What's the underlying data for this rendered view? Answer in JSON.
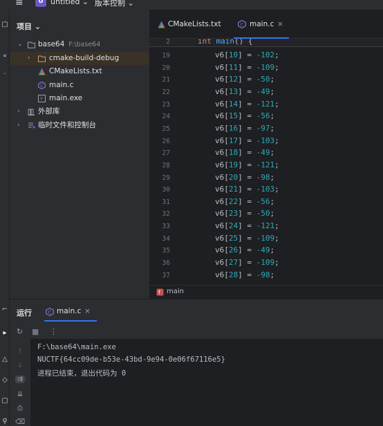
{
  "title_bar": {
    "menu_icon": "hamburger-icon",
    "project_badge": "U",
    "project_name": "untitled ⌄",
    "vcs_label": "版本控制 ⌄"
  },
  "project_panel": {
    "header": "项目 ⌄",
    "tree": [
      {
        "label": "base64",
        "path": "F:\\base64",
        "icon": "folder-icon"
      },
      {
        "label": "cmake-build-debug",
        "icon": "folder-icon"
      },
      {
        "label": "CMakeLists.txt",
        "icon": "cmake-icon"
      },
      {
        "label": "main.c",
        "icon": "c-file-icon"
      },
      {
        "label": "main.exe",
        "icon": "exe-icon"
      },
      {
        "label": "外部库",
        "icon": "library-icon"
      },
      {
        "label": "临时文件和控制台",
        "icon": "scratch-icon"
      }
    ]
  },
  "editor": {
    "tabs": [
      {
        "label": "CMakeLists.txt",
        "icon": "cmake-icon"
      },
      {
        "label": "main.c",
        "icon": "c-file-icon",
        "close": "×"
      }
    ],
    "sticky": {
      "line": "2",
      "pre": "int ",
      "fn": "main",
      "post": "() {"
    },
    "lines": [
      {
        "n": "19",
        "idx": "10",
        "val": "-102"
      },
      {
        "n": "20",
        "idx": "11",
        "val": "-109"
      },
      {
        "n": "21",
        "idx": "12",
        "val": "-50"
      },
      {
        "n": "22",
        "idx": "13",
        "val": "-49"
      },
      {
        "n": "23",
        "idx": "14",
        "val": "-121"
      },
      {
        "n": "24",
        "idx": "15",
        "val": "-56"
      },
      {
        "n": "25",
        "idx": "16",
        "val": "-97"
      },
      {
        "n": "26",
        "idx": "17",
        "val": "-103"
      },
      {
        "n": "27",
        "idx": "18",
        "val": "-49"
      },
      {
        "n": "28",
        "idx": "19",
        "val": "-121"
      },
      {
        "n": "29",
        "idx": "20",
        "val": "-98"
      },
      {
        "n": "30",
        "idx": "21",
        "val": "-103"
      },
      {
        "n": "31",
        "idx": "22",
        "val": "-56"
      },
      {
        "n": "32",
        "idx": "23",
        "val": "-50"
      },
      {
        "n": "33",
        "idx": "24",
        "val": "-121"
      },
      {
        "n": "34",
        "idx": "25",
        "val": "-109"
      },
      {
        "n": "35",
        "idx": "26",
        "val": "-49"
      },
      {
        "n": "36",
        "idx": "27",
        "val": "-109"
      },
      {
        "n": "37",
        "idx": "28",
        "val": "-98"
      }
    ],
    "breadcrumb": "main"
  },
  "run_panel": {
    "title": "运行",
    "tab": {
      "label": "main.c",
      "close": "×"
    },
    "console": [
      "F:\\base64\\main.exe",
      "NUCTF{64cc09de-b53e-43bd-9e94-0e06f67116e5}",
      "进程已结束，退出代码为 0"
    ]
  },
  "colors": {
    "accent": "#3574f0",
    "keyword": "#cf8e6d",
    "function": "#56a8f5",
    "number": "#2aacb8"
  }
}
